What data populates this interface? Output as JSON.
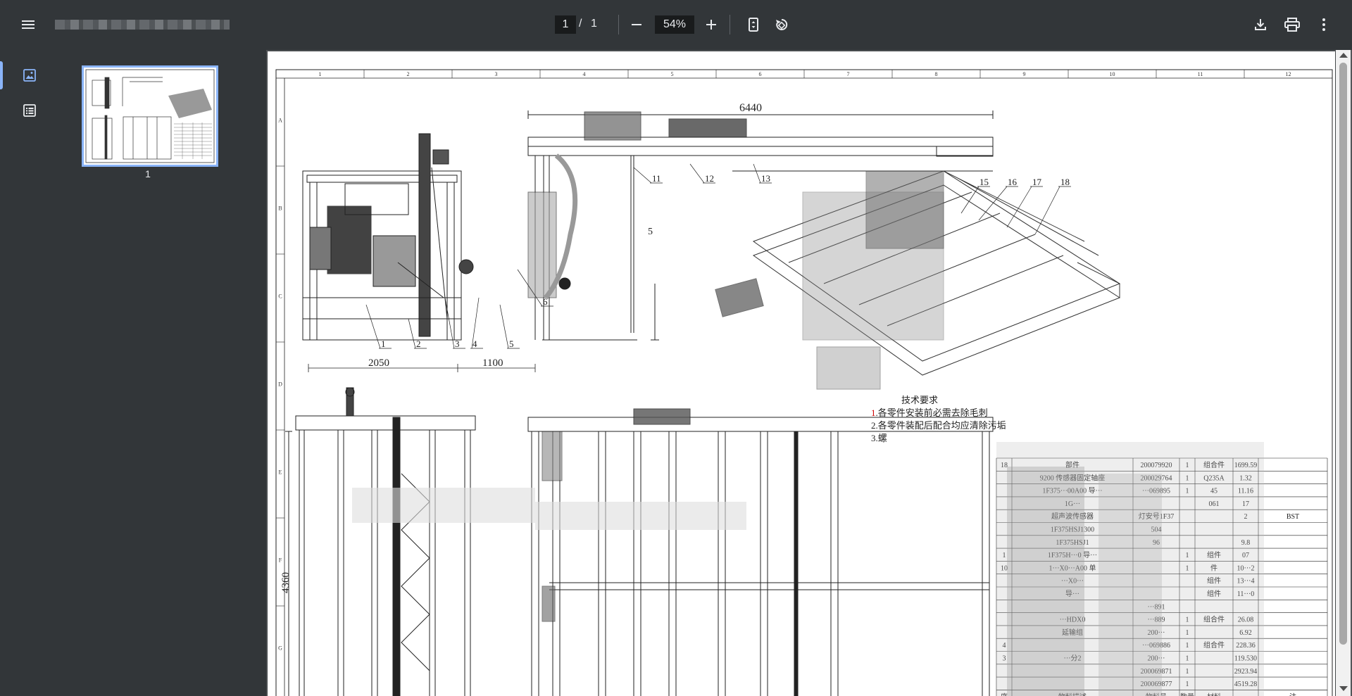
{
  "toolbar": {
    "page_current": "1",
    "page_separator": "/",
    "page_total": "1",
    "zoom": "54%"
  },
  "sidebar": {
    "thumbnail_label": "1"
  },
  "drawing": {
    "column_numbers": [
      "1",
      "2",
      "3",
      "4",
      "5",
      "6",
      "7",
      "8",
      "9",
      "10",
      "11",
      "12"
    ],
    "row_letters": [
      "A",
      "B",
      "C",
      "D",
      "E",
      "F",
      "G"
    ],
    "dimensions": {
      "top_width": "6440",
      "left_width": "2050",
      "mid_width": "1100",
      "height": "4360"
    },
    "balloons": [
      "1",
      "2",
      "3",
      "4",
      "5",
      "6",
      "11",
      "12",
      "13",
      "15",
      "16",
      "17",
      "18"
    ],
    "notes": {
      "title": "技术要求",
      "line1": "1.各零件安装前必需去除毛刺",
      "line2": "2.各零件装配后配合均应清除污垢",
      "line3": "3.螺"
    },
    "bom_rows": [
      {
        "no": "18",
        "desc": "部件",
        "code": "200079920",
        "qty": "1",
        "mat": "组合件",
        "wt": "1699.59",
        "note": ""
      },
      {
        "no": "",
        "desc": "9200 传感器固定轴座",
        "code": "200029764",
        "qty": "1",
        "mat": "Q235A",
        "wt": "1.32",
        "note": ""
      },
      {
        "no": "",
        "desc": "1F375···00A00 导···",
        "code": "···069895",
        "qty": "1",
        "mat": "45",
        "wt": "11.16",
        "note": ""
      },
      {
        "no": "",
        "desc": "1G···",
        "code": "",
        "qty": "",
        "mat": "061",
        "wt": "17",
        "note": ""
      },
      {
        "no": "",
        "desc": "超声波传感器",
        "code": "灯安号1F37",
        "qty": "",
        "mat": "",
        "wt": "2",
        "note": "BST"
      },
      {
        "no": "",
        "desc": "1F375HSJ1300",
        "code": "504",
        "qty": "",
        "mat": "",
        "wt": "",
        "note": ""
      },
      {
        "no": "",
        "desc": "1F375HSJ1",
        "code": "96",
        "qty": "",
        "mat": "",
        "wt": "9.8",
        "note": ""
      },
      {
        "no": "1",
        "desc": "1F375H···0 导···",
        "code": "",
        "qty": "1",
        "mat": "组件",
        "wt": "07",
        "note": ""
      },
      {
        "no": "10",
        "desc": "1···X0···A00 单",
        "code": "",
        "qty": "1",
        "mat": "件",
        "wt": "10···2",
        "note": ""
      },
      {
        "no": "",
        "desc": "···X0···",
        "code": "",
        "qty": "",
        "mat": "组件",
        "wt": "13···4",
        "note": ""
      },
      {
        "no": "",
        "desc": "导···",
        "code": "",
        "qty": "",
        "mat": "组件",
        "wt": "11···0",
        "note": ""
      },
      {
        "no": "",
        "desc": "",
        "code": "···891",
        "qty": "",
        "mat": "",
        "wt": "",
        "note": ""
      },
      {
        "no": "",
        "desc": "···HDX0",
        "code": "···889",
        "qty": "1",
        "mat": "组合件",
        "wt": "26.08",
        "note": ""
      },
      {
        "no": "",
        "desc": "延输组",
        "code": "200···",
        "qty": "1",
        "mat": "",
        "wt": "6.92",
        "note": ""
      },
      {
        "no": "4",
        "desc": "",
        "code": "···069886",
        "qty": "1",
        "mat": "组合件",
        "wt": "228.36",
        "note": ""
      },
      {
        "no": "3",
        "desc": "···分2",
        "code": "200···",
        "qty": "1",
        "mat": "",
        "wt": "119.530",
        "note": ""
      },
      {
        "no": "",
        "desc": "",
        "code": "200069871",
        "qty": "1",
        "mat": "",
        "wt": "2923.94",
        "note": ""
      },
      {
        "no": "",
        "desc": "",
        "code": "200069877",
        "qty": "1",
        "mat": "",
        "wt": "4519.28",
        "note": ""
      }
    ],
    "bom_header": {
      "no": "序",
      "desc": "物料描述",
      "code": "物料号",
      "qty": "数量",
      "mat": "材料",
      "note": "注"
    }
  }
}
